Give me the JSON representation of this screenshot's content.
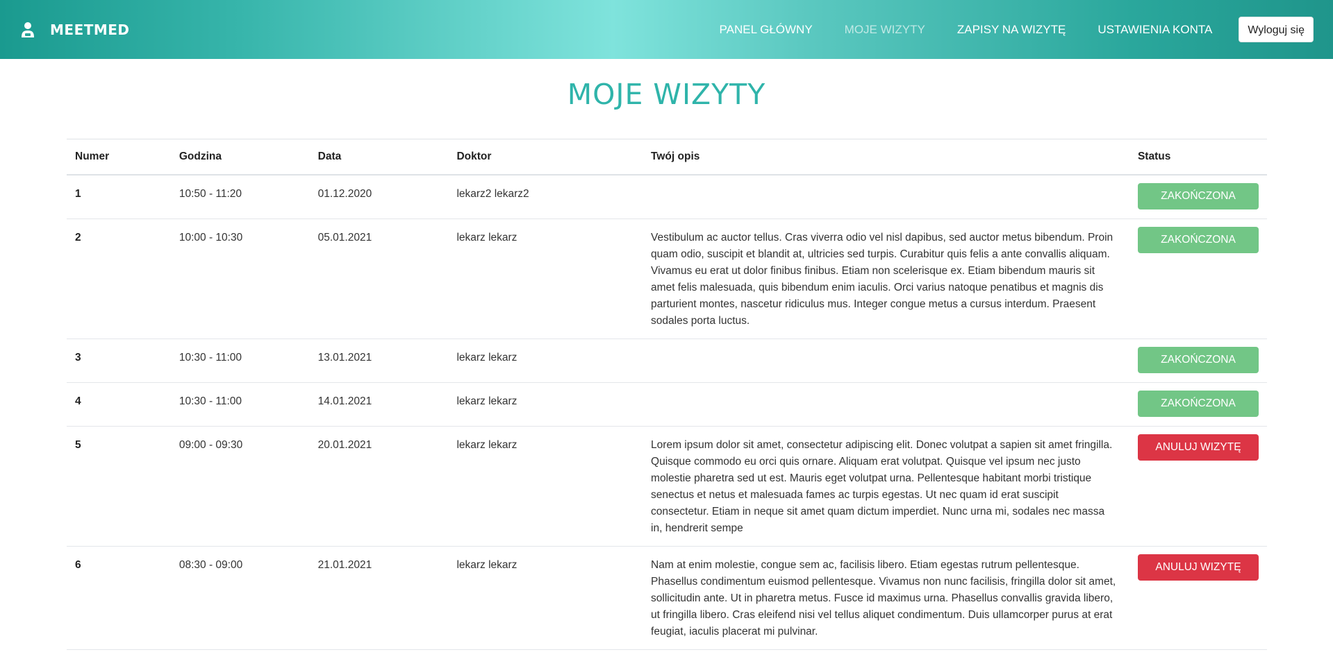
{
  "app": {
    "brand": "MEETMED"
  },
  "nav": {
    "items": [
      {
        "label": "PANEL GŁÓWNY",
        "active": false
      },
      {
        "label": "MOJE WIZYTY",
        "active": true
      },
      {
        "label": "ZAPISY NA WIZYTĘ",
        "active": false
      },
      {
        "label": "USTAWIENIA KONTA",
        "active": false
      }
    ],
    "logout_label": "Wyloguj się"
  },
  "page": {
    "title": "MOJE WIZYTY"
  },
  "table": {
    "headers": [
      "Numer",
      "Godzina",
      "Data",
      "Doktor",
      "Twój opis",
      "Status"
    ],
    "rows": [
      {
        "number": "1",
        "time": "10:50 - 11:20",
        "date": "01.12.2020",
        "doctor": "lekarz2 lekarz2",
        "description": "",
        "status": "ZAKOŃCZONA",
        "status_type": "done"
      },
      {
        "number": "2",
        "time": "10:00 - 10:30",
        "date": "05.01.2021",
        "doctor": "lekarz lekarz",
        "description": "Vestibulum ac auctor tellus. Cras viverra odio vel nisl dapibus, sed auctor metus bibendum. Proin quam odio, suscipit et blandit at, ultricies sed turpis. Curabitur quis felis a ante convallis aliquam. Vivamus eu erat ut dolor finibus finibus. Etiam non scelerisque ex. Etiam bibendum mauris sit amet felis malesuada, quis bibendum enim iaculis. Orci varius natoque penatibus et magnis dis parturient montes, nascetur ridiculus mus. Integer congue metus a cursus interdum. Praesent sodales porta luctus.",
        "status": "ZAKOŃCZONA",
        "status_type": "done"
      },
      {
        "number": "3",
        "time": "10:30 - 11:00",
        "date": "13.01.2021",
        "doctor": "lekarz lekarz",
        "description": "",
        "status": "ZAKOŃCZONA",
        "status_type": "done"
      },
      {
        "number": "4",
        "time": "10:30 - 11:00",
        "date": "14.01.2021",
        "doctor": "lekarz lekarz",
        "description": "",
        "status": "ZAKOŃCZONA",
        "status_type": "done"
      },
      {
        "number": "5",
        "time": "09:00 - 09:30",
        "date": "20.01.2021",
        "doctor": "lekarz lekarz",
        "description": "Lorem ipsum dolor sit amet, consectetur adipiscing elit. Donec volutpat a sapien sit amet fringilla. Quisque commodo eu orci quis ornare. Aliquam erat volutpat. Quisque vel ipsum nec justo molestie pharetra sed ut est. Mauris eget volutpat urna. Pellentesque habitant morbi tristique senectus et netus et malesuada fames ac turpis egestas. Ut nec quam id erat suscipit consectetur. Etiam in neque sit amet quam dictum imperdiet. Nunc urna mi, sodales nec massa in, hendrerit sempe",
        "status": "ANULUJ WIZYTĘ",
        "status_type": "cancel"
      },
      {
        "number": "6",
        "time": "08:30 - 09:00",
        "date": "21.01.2021",
        "doctor": "lekarz lekarz",
        "description": "Nam at enim molestie, congue sem ac, facilisis libero. Etiam egestas rutrum pellentesque. Phasellus condimentum euismod pellentesque. Vivamus non nunc facilisis, fringilla dolor sit amet, sollicitudin ante. Ut in pharetra metus. Fusce id maximus urna. Phasellus convallis gravida libero, ut fringilla libero. Cras eleifend nisi vel tellus aliquet condimentum. Duis ullamcorper purus at erat feugiat, iaculis placerat mi pulvinar.",
        "status": "ANULUJ WIZYTĘ",
        "status_type": "cancel"
      }
    ]
  },
  "colors": {
    "accent": "#2fb4aa",
    "status_done": "#72c686",
    "status_cancel": "#dc3545"
  },
  "icons": {
    "brand": "user-doctor-icon"
  }
}
